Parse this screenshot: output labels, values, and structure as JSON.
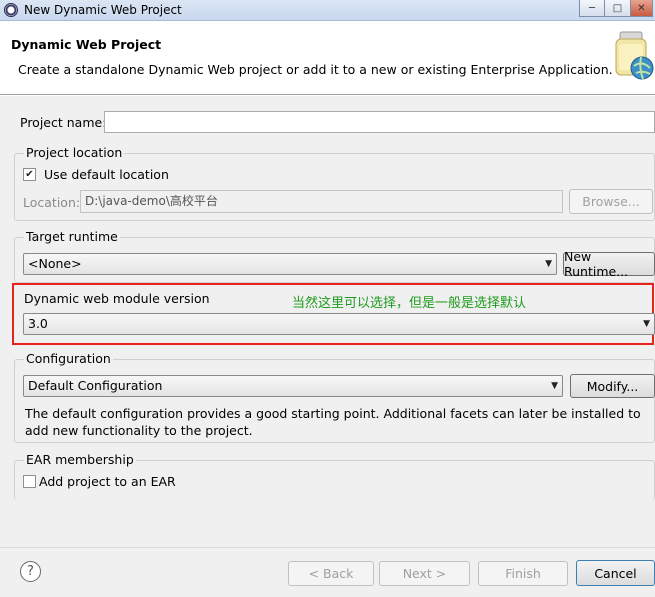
{
  "window": {
    "title": "New Dynamic Web Project",
    "minimize": "─",
    "maximize": "□",
    "close": "✕"
  },
  "banner": {
    "title": "Dynamic Web Project",
    "description": "Create a standalone Dynamic Web project or add it to a new or existing Enterprise Application.",
    "icon": "web-project-jar-icon"
  },
  "project": {
    "name_label": "Project name:",
    "name_value": ""
  },
  "location": {
    "group_label": "Project location",
    "use_default_label": "Use default location",
    "use_default_checked": true,
    "location_label": "Location:",
    "location_value": "D:\\java-demo\\高校平台",
    "browse_label": "Browse..."
  },
  "runtime": {
    "group_label": "Target runtime",
    "selected": "<None>",
    "new_runtime_label": "New Runtime..."
  },
  "module": {
    "group_label": "Dynamic web module version",
    "selected": "3.0",
    "annotation": "当然这里可以选择，但是一般是选择默认",
    "highlight_color": "#e8221a",
    "annotation_color": "#1e9b1e"
  },
  "configuration": {
    "group_label": "Configuration",
    "selected": "Default Configuration",
    "modify_label": "Modify...",
    "description": "The default configuration provides a good starting point. Additional facets can later be installed to add new functionality to the project."
  },
  "ear": {
    "group_label": "EAR membership",
    "add_label": "Add project to an EAR",
    "add_checked": false
  },
  "footer": {
    "help": "?",
    "back_label": "< Back",
    "next_label": "Next >",
    "finish_label": "Finish",
    "cancel_label": "Cancel"
  }
}
